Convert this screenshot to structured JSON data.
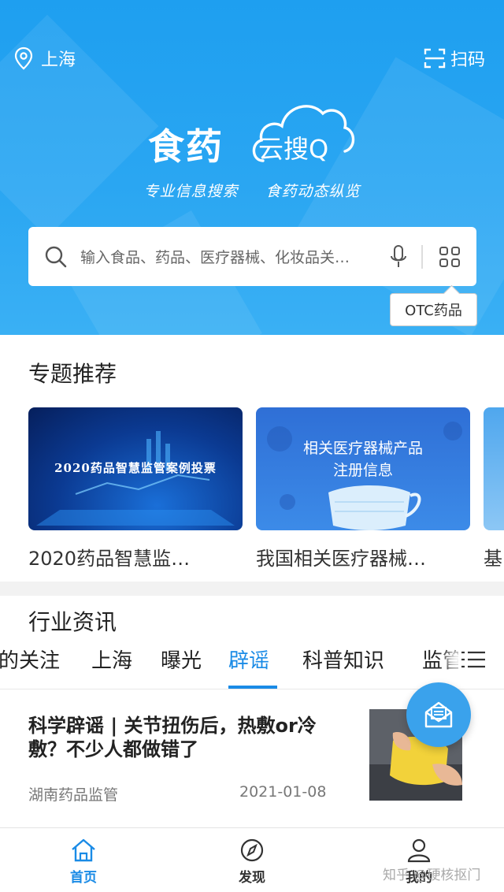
{
  "header": {
    "location": "上海",
    "scan_label": "扫码",
    "brand": "食药",
    "brand_sub": "云搜Q",
    "tagline_left": "专业信息搜索",
    "tagline_right": "食药动态纵览"
  },
  "search": {
    "placeholder": "输入食品、药品、医疗器械、化妆品关…",
    "tooltip": "OTC药品"
  },
  "topics": {
    "title": "专题推荐",
    "cards": [
      {
        "image_text": "2020药品智慧监管案例投票",
        "caption": "2020药品智慧监…"
      },
      {
        "image_text_1": "相关医疗器械产品",
        "image_text_2": "注册信息",
        "caption": "我国相关医疗器械…"
      },
      {
        "caption": "基"
      }
    ]
  },
  "news": {
    "title": "行业资讯",
    "tabs": [
      "的关注",
      "上海",
      "曝光",
      "辟谣",
      "科普知识",
      "监管"
    ],
    "active_tab": "辟谣",
    "article": {
      "title": "科学辟谣 | 关节扭伤后，热敷or冷敷？不少人都做错了",
      "source": "湖南药品监管",
      "date": "2021-01-08"
    }
  },
  "tabbar": {
    "items": [
      "首页",
      "发现",
      "我的"
    ],
    "active": "首页"
  },
  "watermark": "知乎 @硬核抠门",
  "colors": {
    "accent": "#1a8be6",
    "hero_bg": "#2aa6f2"
  }
}
